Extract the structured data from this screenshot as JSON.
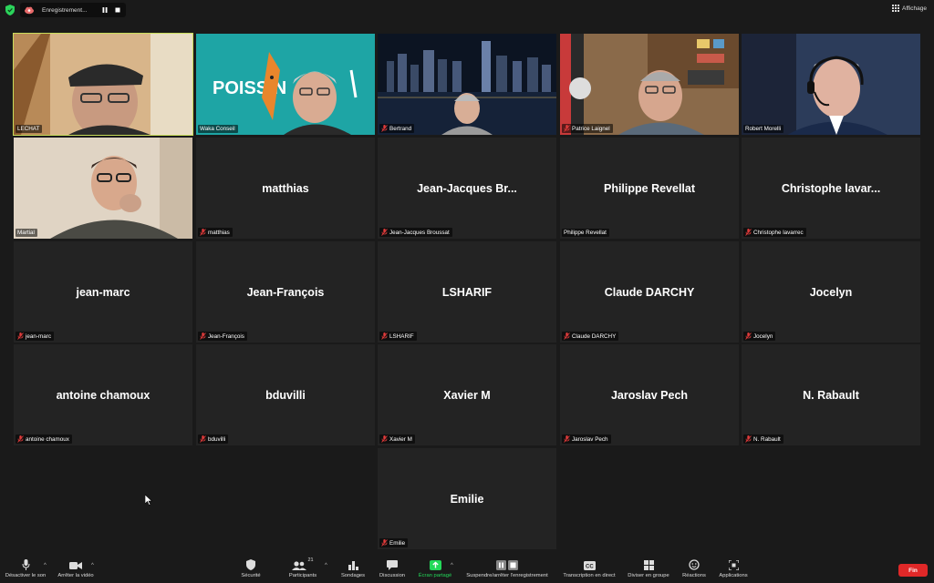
{
  "topbar": {
    "recording_label": "Enregistrement...",
    "view_label": "Affichage"
  },
  "participants": [
    {
      "name": "LECHAT",
      "display": "",
      "video": true,
      "muted": false,
      "active": true
    },
    {
      "name": "Waka Conseil",
      "display": "",
      "video": true,
      "muted": false,
      "active": false,
      "poster_text": "POISS N"
    },
    {
      "name": "Bertrand",
      "display": "",
      "video": true,
      "muted": true,
      "active": false
    },
    {
      "name": "Patrice Laignel",
      "display": "",
      "video": true,
      "muted": true,
      "active": false
    },
    {
      "name": "Robert Morelli",
      "display": "",
      "video": true,
      "muted": false,
      "active": false
    },
    {
      "name": "Martial",
      "display": "",
      "video": true,
      "muted": false,
      "active": false
    },
    {
      "name": "matthias",
      "display": "matthias",
      "video": false,
      "muted": true,
      "active": false
    },
    {
      "name": "Jean-Jacques Broussat",
      "display": "Jean-Jacques  Br...",
      "video": false,
      "muted": true,
      "active": false
    },
    {
      "name": "Philippe Revellat",
      "display": "Philippe Revellat",
      "video": false,
      "muted": false,
      "active": false
    },
    {
      "name": "Christophe lavarrec",
      "display": "Christophe  lavar...",
      "video": false,
      "muted": true,
      "active": false
    },
    {
      "name": "jean-marc",
      "display": "jean-marc",
      "video": false,
      "muted": true,
      "active": false
    },
    {
      "name": "Jean-François",
      "display": "Jean-François",
      "video": false,
      "muted": true,
      "active": false
    },
    {
      "name": "LSHARIF",
      "display": "LSHARIF",
      "video": false,
      "muted": true,
      "active": false
    },
    {
      "name": "Claude DARCHY",
      "display": "Claude DARCHY",
      "video": false,
      "muted": true,
      "active": false
    },
    {
      "name": "Jocelyn",
      "display": "Jocelyn",
      "video": false,
      "muted": true,
      "active": false
    },
    {
      "name": "antoine chamoux",
      "display": "antoine chamoux",
      "video": false,
      "muted": true,
      "active": false
    },
    {
      "name": "bduvilli",
      "display": "bduvilli",
      "video": false,
      "muted": true,
      "active": false
    },
    {
      "name": "Xavier M",
      "display": "Xavier M",
      "video": false,
      "muted": true,
      "active": false
    },
    {
      "name": "Jaroslav Pech",
      "display": "Jaroslav Pech",
      "video": false,
      "muted": true,
      "active": false
    },
    {
      "name": "N. Rabault",
      "display": "N. Rabault",
      "video": false,
      "muted": true,
      "active": false
    },
    {
      "name": "Emilie",
      "display": "Emilie",
      "video": false,
      "muted": true,
      "active": false
    }
  ],
  "toolbar": {
    "mute": "Désactiver le son",
    "stop_video": "Arrêter la vidéo",
    "security": "Sécurité",
    "participants": "Participants",
    "participants_count": "21",
    "polls": "Sondages",
    "chat": "Discussion",
    "share": "Écran partagé",
    "recording": "Suspendre/arrêter l'enregistrement",
    "transcript": "Transcription en direct",
    "breakout": "Diviser en groupe",
    "reactions": "Réactions",
    "apps": "Applications",
    "end": "Fin"
  },
  "colors": {
    "background": "#1a1a1a",
    "tile": "#232323",
    "active_speaker": "#c8dc5a",
    "share_green": "#23d959",
    "end_red": "#e02828",
    "mute_red": "#e03b3b"
  }
}
